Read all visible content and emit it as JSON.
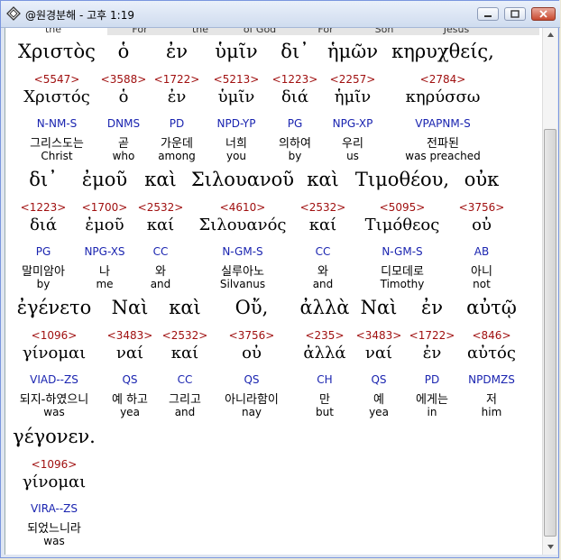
{
  "window": {
    "title": "@원경분해 - 고후 1:19",
    "icon": "diamond-app-icon"
  },
  "header_words": [
    "the",
    "For",
    "the",
    "of God",
    "For",
    "Son",
    "Jesus"
  ],
  "lines": [
    {
      "words": [
        {
          "greek": "Χριστὸς",
          "strong": "<5547>",
          "lexeme": "Χριστός",
          "morph": "N-NM-S",
          "korean": "그리스도는",
          "english": "Christ"
        },
        {
          "greek": "ὁ",
          "strong": "<3588>",
          "lexeme": "ὁ",
          "morph": "DNMS",
          "korean": "곧",
          "english": "who"
        },
        {
          "greek": "ἐν",
          "strong": "<1722>",
          "lexeme": "ἐν",
          "morph": "PD",
          "korean": "가운데",
          "english": "among"
        },
        {
          "greek": "ὑμῖν",
          "strong": "<5213>",
          "lexeme": "ὑμῖν",
          "morph": "NPD-YP",
          "korean": "너희",
          "english": "you"
        },
        {
          "greek": "δι᾽",
          "strong": "<1223>",
          "lexeme": "διά",
          "morph": "PG",
          "korean": "의하여",
          "english": "by"
        },
        {
          "greek": "ἡμῶν",
          "strong": "<2257>",
          "lexeme": "ἡμῖν",
          "morph": "NPG-XP",
          "korean": "우리",
          "english": "us"
        },
        {
          "greek": "κηρυχθείς,",
          "strong": "<2784>",
          "lexeme": "κηρύσσω",
          "morph": "VPAPNM-S",
          "korean": "전파된",
          "english": "was preached"
        }
      ]
    },
    {
      "words": [
        {
          "greek": "δι᾽",
          "strong": "<1223>",
          "lexeme": "διά",
          "morph": "PG",
          "korean": "말미암아",
          "english": "by"
        },
        {
          "greek": "ἐμοῦ",
          "strong": "<1700>",
          "lexeme": "ἐμοῦ",
          "morph": "NPG-XS",
          "korean": "나",
          "english": "me"
        },
        {
          "greek": "καὶ",
          "strong": "<2532>",
          "lexeme": "καί",
          "morph": "CC",
          "korean": "와",
          "english": "and"
        },
        {
          "greek": "Σιλουανοῦ",
          "strong": "<4610>",
          "lexeme": "Σιλουανός",
          "morph": "N-GM-S",
          "korean": "실루아노",
          "english": "Silvanus"
        },
        {
          "greek": "καὶ",
          "strong": "<2532>",
          "lexeme": "καί",
          "morph": "CC",
          "korean": "와",
          "english": "and"
        },
        {
          "greek": "Τιμοθέου,",
          "strong": "<5095>",
          "lexeme": "Τιμόθεος",
          "morph": "N-GM-S",
          "korean": "디모데로",
          "english": "Timothy"
        },
        {
          "greek": "οὐκ",
          "strong": "<3756>",
          "lexeme": "οὐ",
          "morph": "AB",
          "korean": "아니",
          "english": "not"
        }
      ]
    },
    {
      "words": [
        {
          "greek": "ἐγένετο",
          "strong": "<1096>",
          "lexeme": "γίνομαι",
          "morph": "VIAD--ZS",
          "korean": "되지-하였으니",
          "english": "was"
        },
        {
          "greek": "Ναὶ",
          "strong": "<3483>",
          "lexeme": "ναί",
          "morph": "QS",
          "korean": "예 하고",
          "english": "yea"
        },
        {
          "greek": "καὶ",
          "strong": "<2532>",
          "lexeme": "καί",
          "morph": "CC",
          "korean": "그리고",
          "english": "and"
        },
        {
          "greek": "Οὔ,",
          "strong": "<3756>",
          "lexeme": "οὐ",
          "morph": "QS",
          "korean": "아니라함이",
          "english": "nay"
        },
        {
          "greek": "ἀλλὰ",
          "strong": "<235>",
          "lexeme": "ἀλλά",
          "morph": "CH",
          "korean": "만",
          "english": "but"
        },
        {
          "greek": "Ναὶ",
          "strong": "<3483>",
          "lexeme": "ναί",
          "morph": "QS",
          "korean": "예",
          "english": "yea"
        },
        {
          "greek": "ἐν",
          "strong": "<1722>",
          "lexeme": "ἐν",
          "morph": "PD",
          "korean": "에게는",
          "english": "in"
        },
        {
          "greek": "αὐτῷ",
          "strong": "<846>",
          "lexeme": "αὐτός",
          "morph": "NPDMZS",
          "korean": "저",
          "english": "him"
        }
      ]
    },
    {
      "words": [
        {
          "greek": "γέγονεν.",
          "strong": "<1096>",
          "lexeme": "γίνομαι",
          "morph": "VIRA--ZS",
          "korean": "되었느니라",
          "english": "was"
        }
      ]
    }
  ]
}
